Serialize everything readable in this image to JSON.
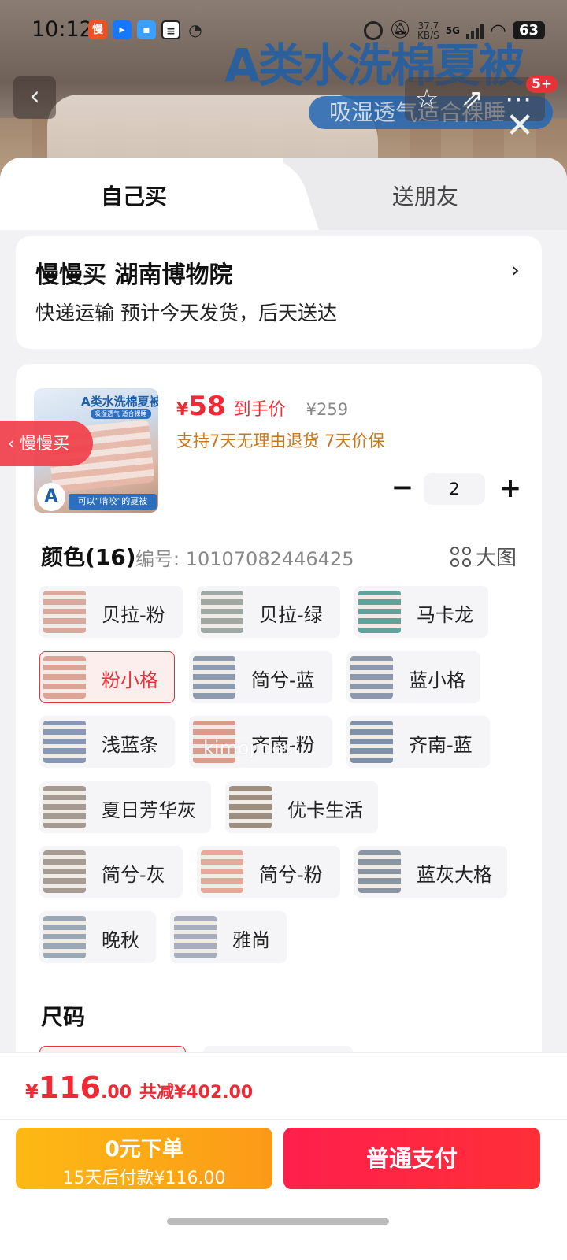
{
  "status_bar": {
    "time": "10:12",
    "net_speed_top": "37.7",
    "net_speed_bottom": "KB/S",
    "network": "5G",
    "battery": "63"
  },
  "banner": {
    "title": "A类水洗棉夏被",
    "subtitle": "吸湿透气适合裸睡",
    "badge": "5+"
  },
  "tabs": {
    "self": "自己买",
    "gift": "送朋友"
  },
  "address": {
    "title": "慢慢买  湖南博物院",
    "delivery": "快递运输 预计今天发货，后天送达"
  },
  "product": {
    "thumb_title": "A类水洗棉夏被",
    "thumb_sub": "吸湿透气 适合裸睡",
    "thumb_bottom": "可以“啃咬”的夏被",
    "thumb_letter": "A",
    "price_symbol": "¥",
    "price": "58",
    "price_label": "到手价",
    "original_price": "¥259",
    "guarantee": "支持7天无理由退货 7天价保",
    "quantity": "2",
    "minus": "−",
    "plus": "+"
  },
  "colors": {
    "heading": "颜色(16)",
    "sku": "编号: 10107082446425",
    "big_pic": "大图",
    "selected": "粉小格",
    "options": [
      {
        "label": "贝拉-粉",
        "color": "#d9a99e"
      },
      {
        "label": "贝拉-绿",
        "color": "#9fa9a4"
      },
      {
        "label": "马卡龙",
        "color": "#5fa39a"
      },
      {
        "label": "粉小格",
        "color": "#dba495"
      },
      {
        "label": "简兮-蓝",
        "color": "#8d9bb0"
      },
      {
        "label": "蓝小格",
        "color": "#8b98ad"
      },
      {
        "label": "浅蓝条",
        "color": "#8898b4"
      },
      {
        "label": "齐南-粉",
        "color": "#d99b8c"
      },
      {
        "label": "齐南-蓝",
        "color": "#7f90a8"
      },
      {
        "label": "夏日芳华灰",
        "color": "#a49a92"
      },
      {
        "label": "优卡生活",
        "color": "#9d8e80"
      },
      {
        "label": "简兮-灰",
        "color": "#a79c94"
      },
      {
        "label": "简兮-粉",
        "color": "#e6a89a"
      },
      {
        "label": "蓝灰大格",
        "color": "#8a95a3"
      },
      {
        "label": "晚秋",
        "color": "#9aa8b6"
      },
      {
        "label": "雅尚",
        "color": "#a6aebd"
      }
    ]
  },
  "size": {
    "heading": "尺码"
  },
  "watermark": "kimojidesu",
  "side_tag": "慢慢买",
  "footer": {
    "currency": "¥",
    "total_int": "116",
    "total_dec": ".00",
    "saving": "共减¥402.00",
    "later_title": "0元下单",
    "later_sub": "15天后付款¥116.00",
    "pay": "普通支付"
  },
  "colors_theme": {
    "accent": "#f02a35",
    "orange": "#fc9a18",
    "guarantee": "#c8781c"
  }
}
